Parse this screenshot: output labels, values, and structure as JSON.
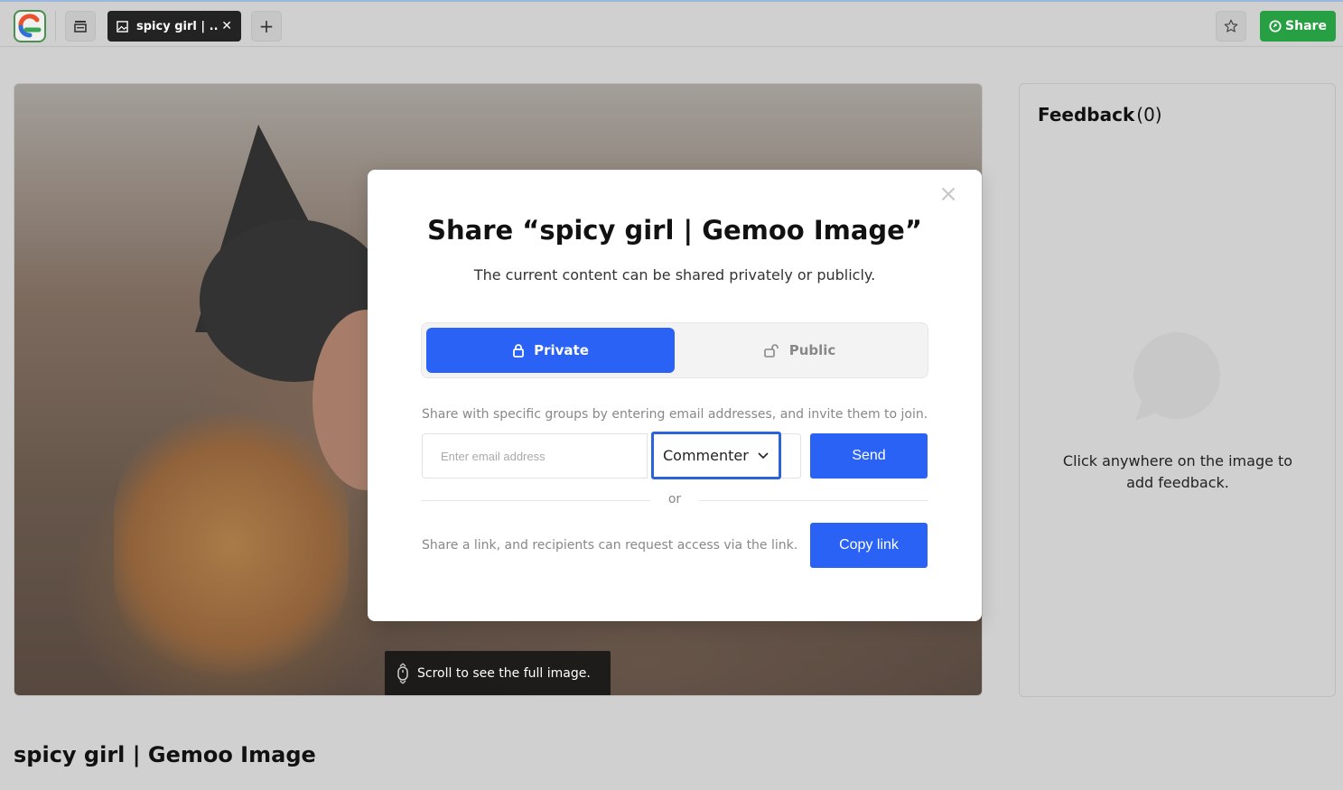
{
  "topbar": {
    "tab_label": "spicy girl | ...",
    "share_label": "Share",
    "accent_color": "#27a043"
  },
  "image": {
    "scroll_hint": "Scroll to see the full image."
  },
  "feedback": {
    "title": "Feedback",
    "count": "(0)",
    "empty_text": "Click anywhere on the image to add feedback."
  },
  "page": {
    "title": "spicy girl | Gemoo Image"
  },
  "modal": {
    "title": "Share “spicy girl | Gemoo Image”",
    "subtitle": "The current content can be shared privately or publicly.",
    "private_label": "Private",
    "public_label": "Public",
    "hint_email": "Share with specific groups by entering email addresses, and invite them to join.",
    "email_placeholder": "Enter email address",
    "email_value": "",
    "role_value": "Commenter",
    "send_label": "Send",
    "or_label": "or",
    "hint_link": "Share a link, and recipients can request access via the link.",
    "copy_label": "Copy link",
    "primary_color": "#2962f5"
  }
}
